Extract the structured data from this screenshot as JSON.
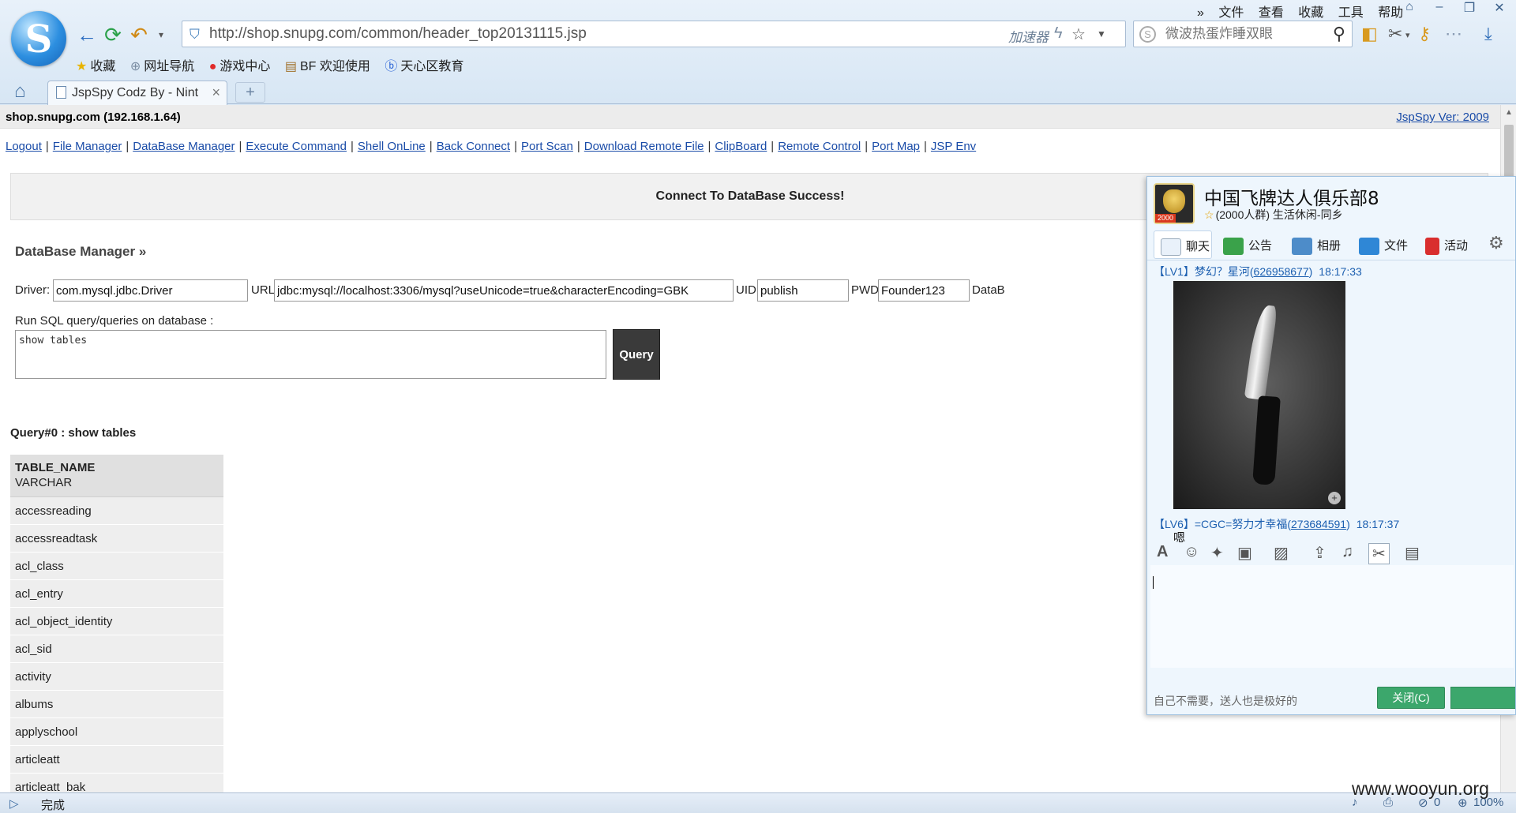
{
  "browser": {
    "address": "http://shop.snupg.com/common/header_top20131115.jsp",
    "accelerator_label": "加速器",
    "search_placeholder": "微波热蛋炸睡双眼",
    "menu": [
      "文件",
      "查看",
      "收藏",
      "工具",
      "帮助"
    ],
    "menu_more": "»",
    "favorites": [
      {
        "icon": "star-icon",
        "label": "收藏"
      },
      {
        "icon": "globe-icon",
        "label": "网址导航"
      },
      {
        "icon": "game-icon",
        "label": "游戏中心"
      },
      {
        "icon": "bookmark-icon",
        "label": "BF 欢迎使用"
      },
      {
        "icon": "baidu-icon",
        "label": "天心区教育"
      }
    ],
    "tab_title": "JspSpy Codz By - Nint",
    "new_tab_label": "+"
  },
  "page": {
    "host": "shop.snupg.com (192.168.1.64)",
    "version_link": "JspSpy Ver: 2009",
    "menu_links": [
      "Logout",
      "File Manager",
      "DataBase Manager",
      "Execute Command",
      "Shell OnLine",
      "Back Connect",
      "Port Scan",
      "Download Remote File",
      "ClipBoard",
      "Remote Control",
      "Port Map",
      "JSP Env"
    ],
    "success_message": "Connect To DataBase Success!",
    "section_title": "DataBase Manager »",
    "connection": {
      "driver_label": "Driver:",
      "driver_value": "com.mysql.jdbc.Driver",
      "url_label": "URL:",
      "url_value": "jdbc:mysql://localhost:3306/mysql?useUnicode=true&characterEncoding=GBK",
      "uid_label": "UID:",
      "uid_value": "publish",
      "pwd_label": "PWD:",
      "pwd_value": "Founder123",
      "db_label_partial": "DataB"
    },
    "sql_label": "Run SQL query/queries on database :",
    "sql_value": "show tables",
    "query_button": "Query",
    "query_title": "Query#0 : show tables",
    "result": {
      "column": "TABLE_NAME",
      "type": "VARCHAR",
      "rows": [
        "accessreading",
        "accessreadtask",
        "acl_class",
        "acl_entry",
        "acl_object_identity",
        "acl_sid",
        "activity",
        "albums",
        "applyschool",
        "articleatt",
        "articleatt_bak"
      ]
    }
  },
  "qq": {
    "group_name": "中国飞牌达人俱乐部8",
    "group_sub": "(2000人群) 生活休闲-同乡",
    "avatar_badge": "2000",
    "tabs": [
      "聊天",
      "公告",
      "相册",
      "文件",
      "活动"
    ],
    "messages": [
      {
        "level": "【LV1】梦幻？星河(",
        "qq": "626958677",
        "close": ")",
        "time": "18:17:33"
      },
      {
        "level": "【LV6】=CGC=努力才幸福(",
        "qq": "273684591",
        "close": ")",
        "time": "18:17:37",
        "text": "嗯"
      }
    ],
    "footer_text": "自己不需要，送人也是极好的",
    "close_button": "关闭(C)"
  },
  "status": {
    "text": "完成",
    "sound_icon": "speaker-icon",
    "counter": "0",
    "zoom": "100%"
  },
  "watermark": "www.wooyun.org",
  "colors": {
    "link": "#1a4ca8",
    "chrome": "#dbe8f5",
    "qq_button": "#3ca76c"
  }
}
